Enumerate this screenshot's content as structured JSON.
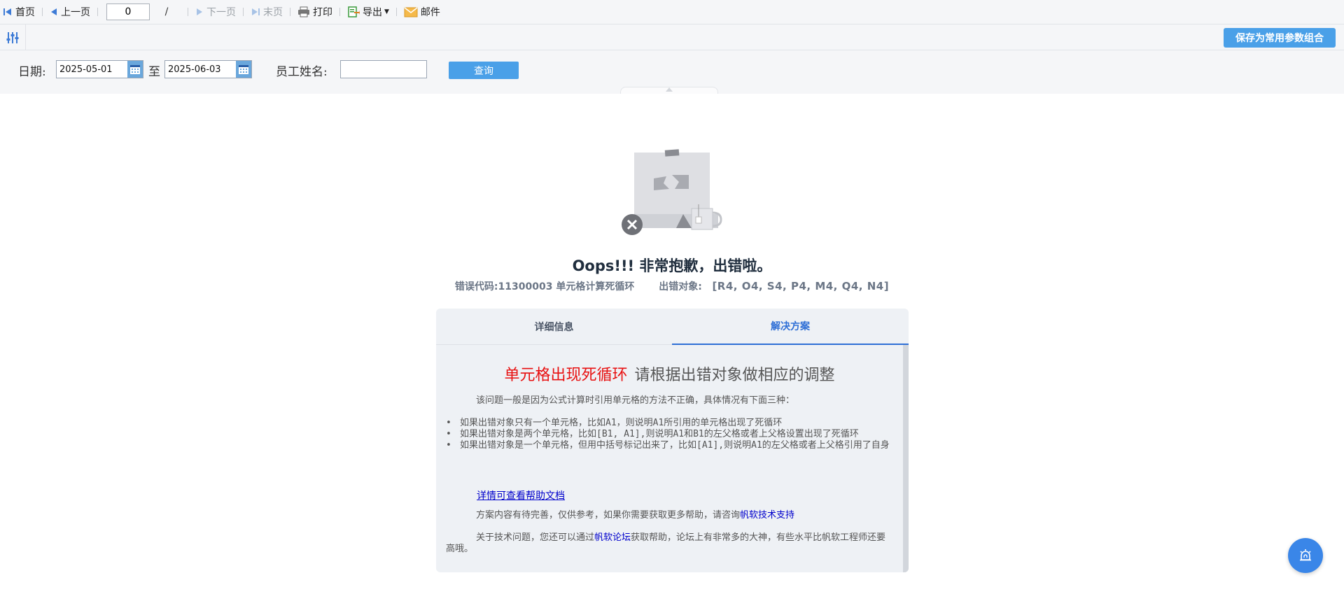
{
  "toolbar": {
    "first_page": "首页",
    "prev_page": "上一页",
    "page_current": "0",
    "page_slash": "/",
    "next_page": "下一页",
    "last_page": "末页",
    "print": "打印",
    "export": "导出",
    "mail": "邮件"
  },
  "params": {
    "save_combo": "保存为常用参数组合",
    "date_label": "日期:",
    "date_from": "2025-05-01",
    "to_label": "至",
    "date_to": "2025-06-03",
    "employee_label": "员工姓名:",
    "employee_value": "",
    "query_button": "查询"
  },
  "error": {
    "title": "Oops!!! 非常抱歉，出错啦。",
    "code": "错误代码:11300003 单元格计算死循环",
    "object_label": "出错对象:",
    "object_value": "[R4, O4, S4, P4, M4, Q4, N4]",
    "tabs": [
      "详细信息",
      "解决方案"
    ],
    "active_tab": 1,
    "solution": {
      "heading_red": "单元格出现死循环",
      "heading_gray": "请根据出错对象做相应的调整",
      "intro": "该问题一般是因为公式计算时引用单元格的方法不正确，具体情况有下面三种：",
      "bullets": [
        "如果出错对象只有一个单元格，比如A1，则说明A1所引用的单元格出现了死循环",
        "如果出错对象是两个单元格，比如[B1, A1],则说明A1和B1的左父格或者上父格设置出现了死循环",
        "如果出错对象是一个单元格，但用中括号标记出来了，比如[A1],则说明A1的左父格或者上父格引用了自身"
      ],
      "help_link": "详情可查看帮助文档",
      "p3_text": "方案内容有待完善，仅供参考，如果你需要获取更多帮助，请咨询",
      "p3_link": "帆软技术支持",
      "p4_pre": "关于技术问题，您还可以通过",
      "p4_link": "帆软论坛",
      "p4_post": "获取帮助，论坛上有非常多的大神，有些水平比帆软工程师还要高哦。"
    }
  },
  "colors": {
    "accent": "#4aa0e8",
    "error_red": "#e81010",
    "link_blue": "#0000cc",
    "float_button": "#3a86e8"
  },
  "icons": [
    "first-page-icon",
    "prev-page-icon",
    "next-page-icon",
    "last-page-icon",
    "print-icon",
    "export-icon",
    "mail-icon",
    "filter-settings-icon",
    "calendar-icon",
    "broken-image-icon",
    "close-circle-icon",
    "mug-icon",
    "alarm-icon"
  ]
}
